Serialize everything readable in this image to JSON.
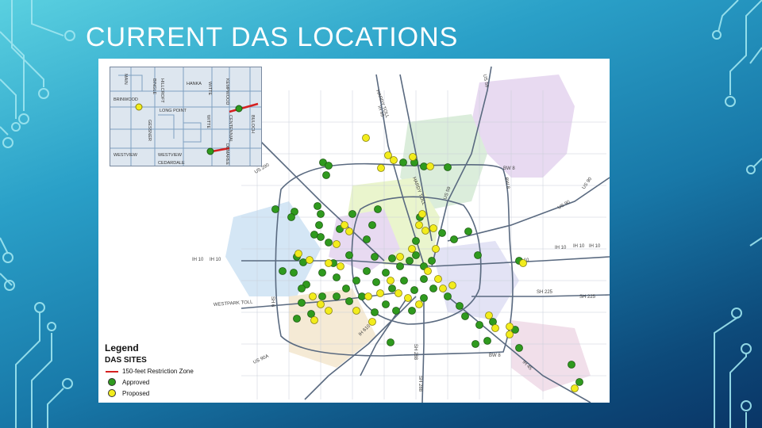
{
  "slide": {
    "title": "CURRENT DAS LOCATIONS"
  },
  "map": {
    "legend": {
      "title": "Legend",
      "subtitle": "DAS SITES",
      "items": [
        {
          "label": "150-feet Restriction Zone",
          "symbol": "red-line",
          "color": "#d62020"
        },
        {
          "label": "Approved",
          "symbol": "circle",
          "color": "#2f9a1e"
        },
        {
          "label": "Proposed",
          "symbol": "circle",
          "color": "#f2ec1c"
        }
      ]
    },
    "road_labels": [
      "HARDY TOLL",
      "US 59",
      "IH 45",
      "BW 8",
      "HARDY TOLL",
      "US 59",
      "BW 8",
      "US 90",
      "US 90",
      "IH 10",
      "IH 10",
      "IH 10",
      "IH 10",
      "IH 10",
      "IH 10",
      "SH 225",
      "SH 225",
      "WESTPARK TOLL",
      "SH 288",
      "BW 8",
      "US 90A",
      "IH 45",
      "SH 6",
      "US 290",
      "IH 610",
      "SH 288"
    ],
    "inset_labels": [
      "MAIN",
      "BRINWOOD",
      "HANKA",
      "WITTE",
      "LONG POINT",
      "BINGLE",
      "GESSNER",
      "WITTE",
      "CENTENNIAL",
      "WESTVIEW",
      "WESTVIEW",
      "CEDARDALE",
      "DEMAREE",
      "BULOCH",
      "KEMPWOOD",
      "HILLCROFT"
    ],
    "colors": {
      "approved": "#2f9a1e",
      "proposed": "#f2ec1c",
      "restriction": "#d62020",
      "roads": "#5a6a80",
      "districts": [
        "#e6d6f0",
        "#d8ecd8",
        "#e8f4c8",
        "#d0e4f4",
        "#f4e8d0",
        "#e0e0f4",
        "#f0dce8"
      ]
    }
  }
}
